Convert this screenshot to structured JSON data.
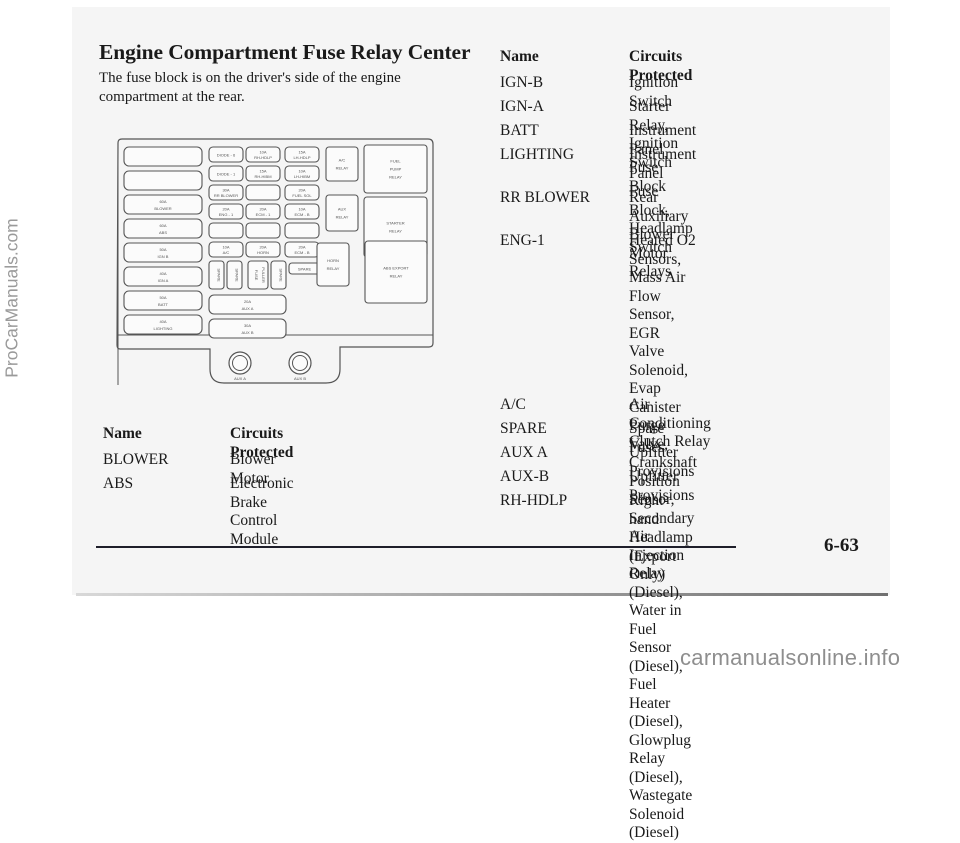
{
  "page": {
    "title": "Engine Compartment Fuse Relay Center",
    "intro": "The fuse block is on the driver's side of the engine compartment at the rear.",
    "page_number": "6-63"
  },
  "diagram": {
    "left_fuses": [
      {
        "amp": "",
        "name": ""
      },
      {
        "amp": "",
        "name": ""
      },
      {
        "amp": "60A",
        "name": "BLOWER"
      },
      {
        "amp": "60A",
        "name": "ABS"
      },
      {
        "amp": "50A",
        "name": "IGN B"
      },
      {
        "amp": "40A",
        "name": "IGN A"
      },
      {
        "amp": "50A",
        "name": "BATT"
      },
      {
        "amp": "40A",
        "name": "LIGHTING"
      }
    ],
    "mini_fuses": [
      [
        "DIODE - 6",
        "10A RH-HDLP",
        "15A LH-HDLP"
      ],
      [
        "DIODE - 1",
        "15A RH-HIBM",
        "10A LH-HIBM"
      ],
      [
        "30A RR BLOWER",
        "",
        "20A FUEL SOL"
      ],
      [
        "20A ENG - 1",
        "20A ECM - 1",
        "10A ECM - B"
      ],
      [
        "",
        "",
        ""
      ],
      [
        "10A A/C",
        "20A HORN",
        "20A ECM - B"
      ]
    ],
    "spare_fuses": [
      "SPARE",
      "SPARE",
      "FUSE PULLER",
      "SPARE"
    ],
    "spare_label": "SPARE",
    "aux_fuses": [
      {
        "amp": "20A",
        "name": "AUX A"
      },
      {
        "amp": "30A",
        "name": "AUX B"
      }
    ],
    "relays": {
      "ac": [
        "A/C",
        "RELAY"
      ],
      "fuel_pump": [
        "FUEL",
        "PUMP",
        "RELAY"
      ],
      "aux": [
        "AUX",
        "RELAY"
      ],
      "starter": [
        "STARTER",
        "RELAY"
      ],
      "horn": [
        "HORN",
        "RELAY"
      ],
      "abs_export": [
        "ABS EXPORT",
        "RELAY"
      ]
    },
    "studs": [
      "AUX A",
      "AUX B"
    ]
  },
  "left_table": {
    "header": {
      "name": "Name",
      "circuits": "Circuits Protected"
    },
    "rows": [
      {
        "name": "BLOWER",
        "circuits": "Blower Motor"
      },
      {
        "name": "ABS",
        "circuits": "Electronic Brake Control Module"
      }
    ]
  },
  "right_table": {
    "header": {
      "name": "Name",
      "circuits": "Circuits Protected"
    },
    "rows": [
      {
        "name": "IGN-B",
        "circuits": "Ignition Switch"
      },
      {
        "name": "IGN-A",
        "circuits": "Starter Relay, Ignition Switch"
      },
      {
        "name": "BATT",
        "circuits": "Instrument Panel Fuse Block"
      },
      {
        "name": "LIGHTING",
        "circuits": "Instrument Panel Fuse Block,\nHeadlamp Switch"
      },
      {
        "name": "RR BLOWER",
        "circuits": "Rear Auxiliary Blower\nMotor Relays"
      },
      {
        "name": "ENG-1",
        "circuits": "Heated O2 Sensors, Mass Air\nFlow Sensor, EGR Valve\nSolenoid, Evap Canister Purge\nValve, Crankshaft Position Sensor,\nSecondary Air Injection Relay\n(Diesel), Water in Fuel Sensor\n(Diesel), Fuel Heater (Diesel),\nGlowplug Relay (Diesel),\nWastegate Solenoid (Diesel)"
      },
      {
        "name": "A/C",
        "circuits": "Air Conditioning Clutch Relay"
      },
      {
        "name": "SPARE",
        "circuits": "Spare Fuses"
      },
      {
        "name": "AUX A",
        "circuits": "Upfitter Provisions"
      },
      {
        "name": "AUX-B",
        "circuits": "Upfitter Provisions"
      },
      {
        "name": "RH-HDLP",
        "circuits": "Right-hand Headlamp\n(Export Only)"
      }
    ]
  },
  "watermarks": {
    "side": "ProCarManuals.com",
    "bottom": "carmanualsonline.info"
  }
}
